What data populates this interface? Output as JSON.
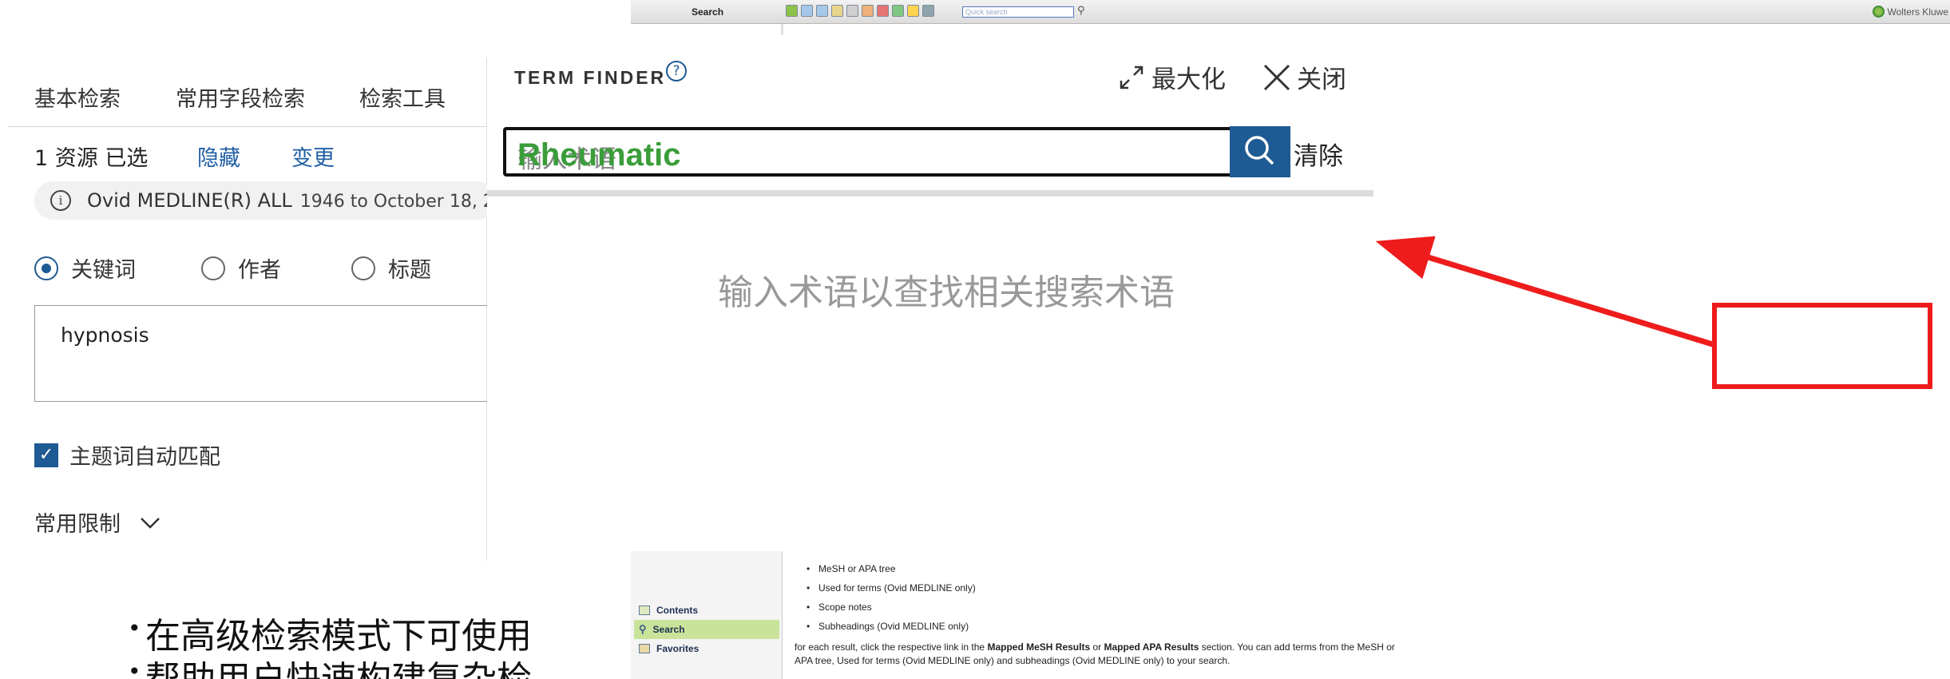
{
  "help_window": {
    "toolbar_label": "Search",
    "quick_search_placeholder": "Quick search",
    "brand": "Wolters Kluwe",
    "sidebar": [
      {
        "label": "Contents",
        "active": false
      },
      {
        "label": "Search",
        "active": true
      },
      {
        "label": "Favorites",
        "active": false
      }
    ],
    "bullets": [
      "MeSH or APA tree",
      "Used for terms (Ovid MEDLINE only)",
      "Scope notes",
      "Subheadings (Ovid MEDLINE only)"
    ],
    "paragraph_pre1": "for each result, click the respective link in the ",
    "paragraph_bold1": "Mapped MeSH Results",
    "paragraph_mid": " or ",
    "paragraph_bold2": "Mapped APA Results",
    "paragraph_post": " section. You can add terms from the MeSH or APA tree, Used for terms (Ovid MEDLINE only) and subheadings (Ovid MEDLINE only) to your search."
  },
  "search_panel": {
    "tabs": [
      "基本检索",
      "常用字段检索",
      "检索工具"
    ],
    "resources_selected": "1 资源 已选",
    "hide_link": "隐藏",
    "change_link": "变更",
    "database_name": "Ovid MEDLINE(R) ALL",
    "database_range": "1946 to October 18, 2",
    "radio_options": [
      {
        "label": "关键词",
        "selected": true
      },
      {
        "label": "作者",
        "selected": false
      },
      {
        "label": "标题",
        "selected": false
      }
    ],
    "query": "hypnosis",
    "auto_map_label": "主题词自动匹配",
    "auto_map_checked": true,
    "limits_label": "常用限制"
  },
  "term_finder": {
    "title": "TERM FINDER",
    "maximize_label": "最大化",
    "close_label": "关闭",
    "input_placeholder": "输入术语",
    "input_value": "Rheumatic",
    "clear_label": "清除",
    "empty_hint": "输入术语以查找相关搜索术语"
  },
  "annotation": {
    "color": "#ee1c1c"
  },
  "slide_bullets": [
    "在高级检索模式下可使用",
    "帮助用户快速构建复杂检"
  ],
  "colors": {
    "accent": "#1e5a93",
    "link": "#1f5fa5",
    "value_green": "#3a9d3a"
  }
}
